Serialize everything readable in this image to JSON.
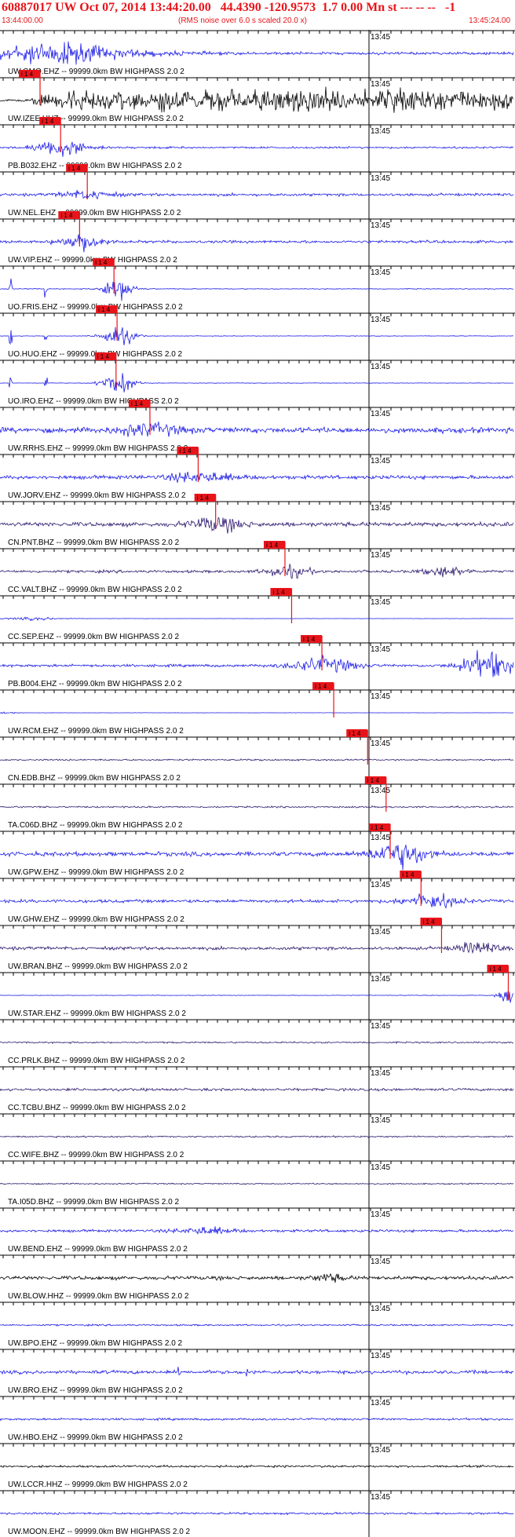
{
  "header": {
    "title": "60887017 UW Oct 07, 2014 13:44:20.00   44.4390 -120.9573  1.7 0.00 Mn st --- -- --   -1",
    "start_time": "13:44:00.00",
    "rms_note": "(RMS noise over 6.0 s scaled 20.0 x)",
    "end_time": "13:45:24.00"
  },
  "time_marker": "13:45",
  "pick_label": "i 1 4",
  "colors": {
    "blue": "#1a1ae6",
    "purple": "#2d1a6e",
    "black": "#000000",
    "red": "#e8141a"
  },
  "traces": [
    {
      "label": "UW.GMO.EHZ -- 99999.0km BW  HIGHPASS  2.0  2",
      "color": "blue",
      "amp": 0.1,
      "burst": [
        0.06,
        0.2,
        0.55
      ],
      "pick": null,
      "gmo": true
    },
    {
      "label": "UW.IZEE.HHZ -- 99999.0km BW  HIGHPASS  2.0  2",
      "color": "black",
      "amp": 0.15,
      "burst": null,
      "pick": 0.078,
      "izee": true
    },
    {
      "label": "PB.B032.EHZ -- 99999.0km BW  HIGHPASS  2.0  2",
      "color": "blue",
      "amp": 0.07,
      "burst": [
        0.12,
        0.05,
        0.6
      ],
      "pick": 0.118
    },
    {
      "label": "UW.NEL.EHZ -- 99999.0km BW  HIGHPASS  2.0  2",
      "color": "blue",
      "amp": 0.1,
      "burst": [
        0.17,
        0.05,
        0.3
      ],
      "pick": 0.17
    },
    {
      "label": "UW.VIP.EHZ -- 99999.0km BW  HIGHPASS  2.0  2",
      "color": "blue",
      "amp": 0.1,
      "burst": [
        0.16,
        0.04,
        0.6
      ],
      "pick": 0.155
    },
    {
      "label": "UO.FRIS.EHZ -- 99999.0km BW  HIGHPASS  2.0  2",
      "color": "blue",
      "amp": 0.03,
      "burst": [
        0.23,
        0.03,
        0.85
      ],
      "pick": 0.222,
      "spikes": [
        0.02,
        0.09
      ]
    },
    {
      "label": "UO.HUO.EHZ -- 99999.0km BW  HIGHPASS  2.0  2",
      "color": "blue",
      "amp": 0.02,
      "burst": [
        0.23,
        0.03,
        0.85
      ],
      "pick": 0.228,
      "spikes": [
        0.02,
        0.09
      ]
    },
    {
      "label": "UO.IRO.EHZ -- 99999.0km BW  HIGHPASS  2.0  2",
      "color": "blue",
      "amp": 0.02,
      "burst": [
        0.23,
        0.03,
        0.85
      ],
      "pick": 0.226,
      "spikes": [
        0.02,
        0.09
      ]
    },
    {
      "label": "UW.RRHS.EHZ -- 99999.0km BW  HIGHPASS  2.0  2",
      "color": "blue",
      "amp": 0.2,
      "burst": [
        0.29,
        0.06,
        0.4
      ],
      "pick": 0.292
    },
    {
      "label": "UW.JORV.EHZ -- 99999.0km BW  HIGHPASS  2.0  2",
      "color": "blue",
      "amp": 0.14,
      "burst": [
        0.39,
        0.06,
        0.35
      ],
      "pick": 0.386
    },
    {
      "label": "CN.PNT.BHZ -- 99999.0km BW  HIGHPASS  2.0  2",
      "color": "purple",
      "amp": 0.16,
      "burst": [
        0.42,
        0.05,
        0.5
      ],
      "pick": 0.42
    },
    {
      "label": "CC.VALT.BHZ -- 99999.0km BW  HIGHPASS  2.0  2",
      "color": "purple",
      "amp": 0.1,
      "burst": [
        0.56,
        0.04,
        0.45
      ],
      "pick": 0.555,
      "burst2": [
        0.87,
        0.04,
        0.35
      ]
    },
    {
      "label": "CC.SEP.EHZ -- 99999.0km BW  HIGHPASS  2.0  2",
      "color": "blue",
      "amp": 0.01,
      "burst": [
        0.07,
        0.05,
        0.12
      ],
      "pick": 0.568
    },
    {
      "label": "PB.B004.EHZ -- 99999.0km BW  HIGHPASS  2.0  2",
      "color": "blue",
      "amp": 0.1,
      "burst": [
        0.63,
        0.06,
        0.55
      ],
      "pick": 0.627,
      "burst2": [
        0.95,
        0.05,
        0.95
      ],
      "raise": 0.45
    },
    {
      "label": "UW.RCM.EHZ -- 99999.0km BW  HIGHPASS  2.0  2",
      "color": "blue",
      "amp": 0.01,
      "burst": [
        0.01,
        0.02,
        0.1
      ],
      "pick": 0.65
    },
    {
      "label": "CN.EDB.BHZ -- 99999.0km BW  HIGHPASS  2.0  2",
      "color": "purple",
      "amp": 0.06,
      "burst": null,
      "pick": 0.716
    },
    {
      "label": "TA.C06D.BHZ -- 99999.0km BW  HIGHPASS  2.0  2",
      "color": "purple",
      "amp": 0.06,
      "burst": null,
      "pick": 0.752
    },
    {
      "label": "UW.GPW.EHZ -- 99999.0km BW  HIGHPASS  2.0  2",
      "color": "blue",
      "amp": 0.16,
      "burst": [
        0.78,
        0.05,
        0.95
      ],
      "pick": 0.76
    },
    {
      "label": "UW.GHW.EHZ -- 99999.0km BW  HIGHPASS  2.0  2",
      "color": "blue",
      "amp": 0.12,
      "burst": [
        0.84,
        0.05,
        0.55
      ],
      "pick": 0.82
    },
    {
      "label": "UW.BRAN.BHZ -- 99999.0km BW  HIGHPASS  2.0  2",
      "color": "purple",
      "amp": 0.12,
      "burst": [
        0.93,
        0.04,
        0.4
      ],
      "pick": 0.86
    },
    {
      "label": "UW.STAR.EHZ -- 99999.0km BW  HIGHPASS  2.0  2",
      "color": "blue",
      "amp": 0.02,
      "burst": [
        0.99,
        0.02,
        0.5
      ],
      "pick": 0.99
    },
    {
      "label": "CC.PRLK.BHZ -- 99999.0km BW  HIGHPASS  2.0  2",
      "color": "purple",
      "amp": 0.06,
      "burst": null,
      "pick": null
    },
    {
      "label": "CC.TCBU.BHZ -- 99999.0km BW  HIGHPASS  2.0  2",
      "color": "purple",
      "amp": 0.1,
      "burst": null,
      "pick": null
    },
    {
      "label": "CC.WIFE.BHZ -- 99999.0km BW  HIGHPASS  2.0  2",
      "color": "purple",
      "amp": 0.06,
      "burst": null,
      "pick": null
    },
    {
      "label": "TA.I05D.BHZ -- 99999.0km BW  HIGHPASS  2.0  2",
      "color": "purple",
      "amp": 0.05,
      "burst": null,
      "pick": null
    },
    {
      "label": "UW.BEND.EHZ -- 99999.0km BW  HIGHPASS  2.0  2",
      "color": "blue",
      "amp": 0.1,
      "burst": [
        0.4,
        0.05,
        0.25
      ],
      "pick": null
    },
    {
      "label": "UW.BLOW.HHZ -- 99999.0km BW  HIGHPASS  2.0  2",
      "color": "black",
      "amp": 0.14,
      "burst": [
        0.64,
        0.03,
        0.25
      ],
      "pick": null
    },
    {
      "label": "UW.BPO.EHZ -- 99999.0km BW  HIGHPASS  2.0  2",
      "color": "blue",
      "amp": 0.06,
      "burst": null,
      "pick": null
    },
    {
      "label": "UW.BRO.EHZ -- 99999.0km BW  HIGHPASS  2.0  2",
      "color": "blue",
      "amp": 0.13,
      "burst": null,
      "pick": null,
      "spikes": [
        0.35,
        0.48
      ]
    },
    {
      "label": "UW.HBO.EHZ -- 99999.0km BW  HIGHPASS  2.0  2",
      "color": "blue",
      "amp": 0.08,
      "burst": null,
      "pick": null
    },
    {
      "label": "UW.LCCR.HHZ -- 99999.0km BW  HIGHPASS  2.0  2",
      "color": "black",
      "amp": 0.08,
      "burst": null,
      "pick": null
    },
    {
      "label": "UW.MOON.EHZ -- 99999.0km BW  HIGHPASS  2.0  2",
      "color": "blue",
      "amp": 0.08,
      "burst": null,
      "pick": null
    }
  ]
}
